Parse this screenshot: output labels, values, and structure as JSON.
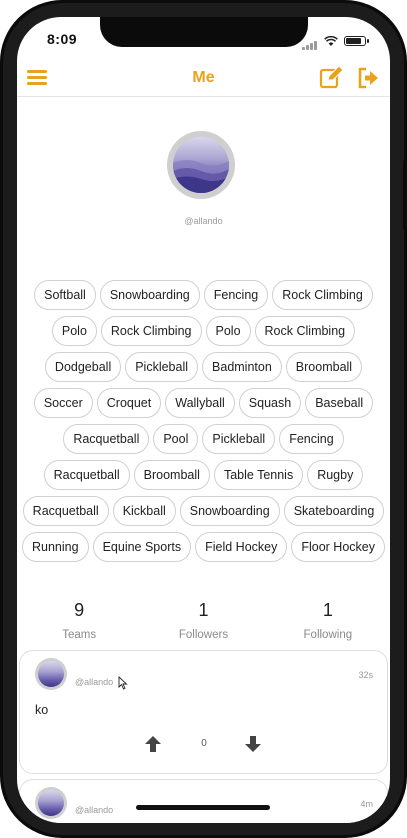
{
  "status_bar": {
    "time": "8:09"
  },
  "nav": {
    "title": "Me"
  },
  "profile": {
    "handle": "@allando"
  },
  "sports_rows": [
    [
      "Softball",
      "Snowboarding",
      "Fencing",
      "Rock Climbing"
    ],
    [
      "Polo",
      "Rock Climbing",
      "Polo",
      "Rock Climbing"
    ],
    [
      "Dodgeball",
      "Pickleball",
      "Badminton",
      "Broomball"
    ],
    [
      "Soccer",
      "Croquet",
      "Wallyball",
      "Squash",
      "Baseball"
    ],
    [
      "Racquetball",
      "Pool",
      "Pickleball",
      "Fencing"
    ],
    [
      "Racquetball",
      "Broomball",
      "Table Tennis",
      "Rugby"
    ],
    [
      "Racquetball",
      "Kickball",
      "Snowboarding",
      "Skateboarding"
    ],
    [
      "Running",
      "Equine Sports",
      "Field Hockey",
      "Floor Hockey"
    ]
  ],
  "stats": [
    {
      "value": "9",
      "label": "Teams"
    },
    {
      "value": "1",
      "label": "Followers"
    },
    {
      "value": "1",
      "label": "Following"
    }
  ],
  "posts": [
    {
      "user": "@allando",
      "time": "32s",
      "body": "ko",
      "votes": "0"
    },
    {
      "user": "@allando",
      "time": "4m"
    }
  ],
  "colors": {
    "accent": "#e8a21c",
    "tag_border": "#d0d0d0",
    "muted_text": "#9a9a9a"
  },
  "icons": {
    "menu": "hamburger-icon",
    "edit": "edit-icon",
    "logout": "logout-icon",
    "up": "arrow-up-icon",
    "down": "arrow-down-icon"
  }
}
